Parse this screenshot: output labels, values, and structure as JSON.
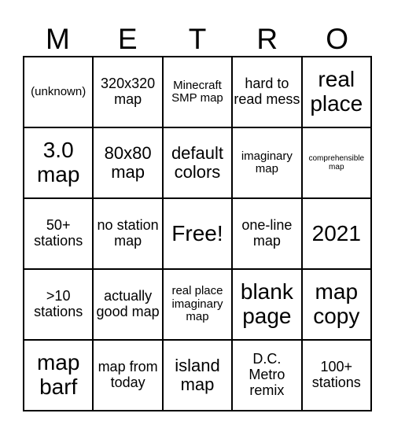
{
  "title_letters": [
    "M",
    "E",
    "T",
    "R",
    "O"
  ],
  "grid": [
    [
      {
        "text": "(unknown)",
        "size": "s4"
      },
      {
        "text": "320x320 map",
        "size": "s3"
      },
      {
        "text": "Minecraft SMP map",
        "size": "s4"
      },
      {
        "text": "hard to read mess",
        "size": "s3"
      },
      {
        "text": "real place",
        "size": "s1"
      }
    ],
    [
      {
        "text": "3.0 map",
        "size": "s1"
      },
      {
        "text": "80x80 map",
        "size": "s2"
      },
      {
        "text": "default colors",
        "size": "s2"
      },
      {
        "text": "imaginary map",
        "size": "s4"
      },
      {
        "text": "comprehensible map",
        "size": "s5"
      }
    ],
    [
      {
        "text": "50+ stations",
        "size": "s3"
      },
      {
        "text": "no station map",
        "size": "s3"
      },
      {
        "text": "Free!",
        "size": "s1"
      },
      {
        "text": "one-line map",
        "size": "s3"
      },
      {
        "text": "2021",
        "size": "s1"
      }
    ],
    [
      {
        "text": ">10 stations",
        "size": "s3"
      },
      {
        "text": "actually good map",
        "size": "s3"
      },
      {
        "text": "real place imaginary map",
        "size": "s4"
      },
      {
        "text": "blank page",
        "size": "s1"
      },
      {
        "text": "map copy",
        "size": "s1"
      }
    ],
    [
      {
        "text": "map barf",
        "size": "s1"
      },
      {
        "text": "map from today",
        "size": "s3"
      },
      {
        "text": "island map",
        "size": "s2"
      },
      {
        "text": "D.C. Metro remix",
        "size": "s3"
      },
      {
        "text": "100+ stations",
        "size": "s3"
      }
    ]
  ]
}
